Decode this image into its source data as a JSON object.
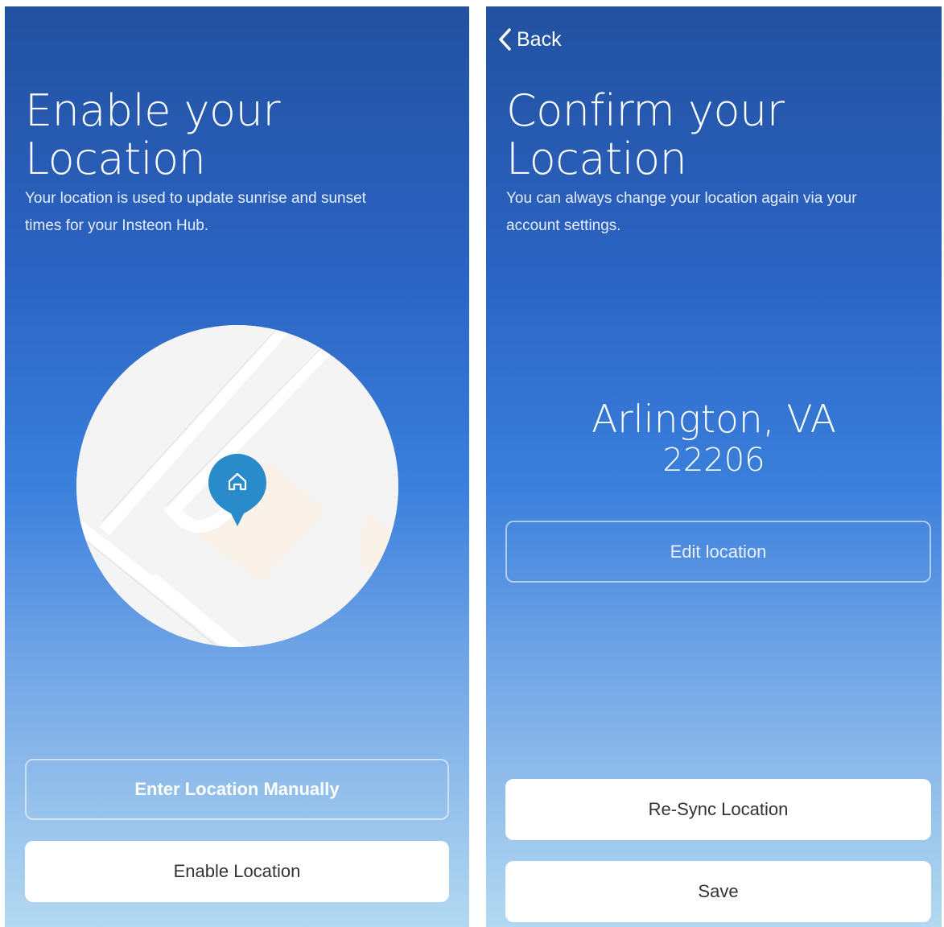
{
  "left_screen": {
    "title": "Enable your Location",
    "subtitle": "Your location is used to update sunrise and sunset times for your Insteon Hub.",
    "map_icon": "home-pin-icon",
    "enter_manually_label": "Enter Location Manually",
    "enable_label": "Enable Location"
  },
  "right_screen": {
    "back_label": "Back",
    "title": "Confirm your Location",
    "subtitle": "You can always change your location again via your account settings.",
    "city": "Arlington, VA",
    "zip": "22206",
    "edit_label": "Edit location",
    "resync_label": "Re-Sync Location",
    "save_label": "Save"
  },
  "colors": {
    "gradient_top": "#2251a0",
    "gradient_mid": "#3a7fdc",
    "gradient_bottom": "#b3d9f1",
    "pin": "#2a8bcb"
  }
}
